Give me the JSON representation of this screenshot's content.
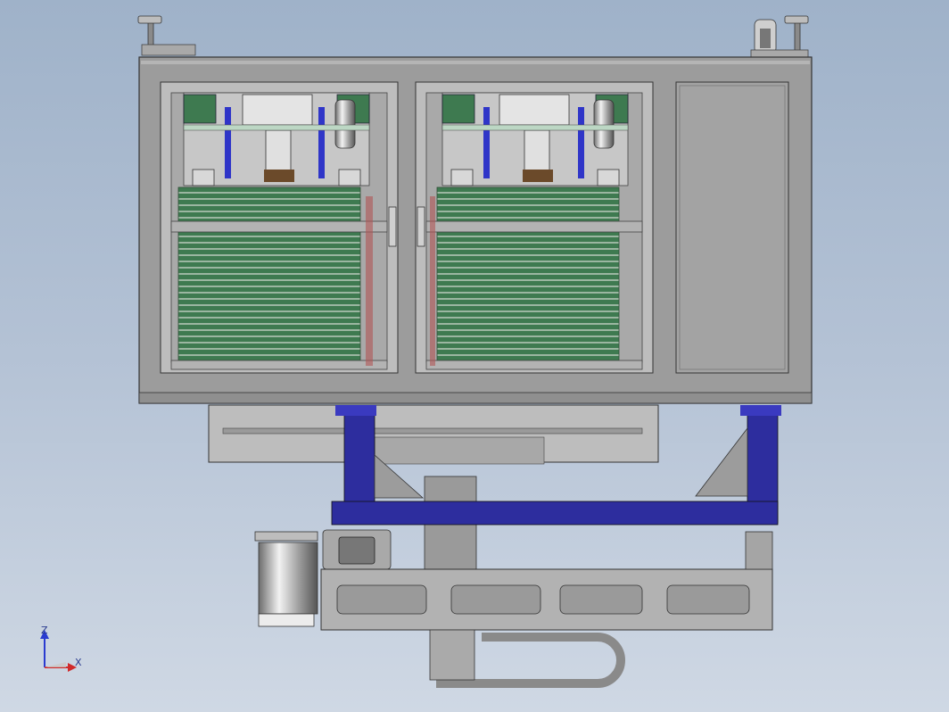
{
  "scene": {
    "background_top": "#9fb2c9",
    "background_bottom": "#cfd8e4",
    "frame_color": "#9c9c9c",
    "tray_color": "#3e7a50",
    "bracket_color": "#2d2d9e"
  },
  "triad": {
    "z_label": "Z",
    "x_label": "X",
    "z_color": "#2a3bd0",
    "x_color": "#d02a2a"
  }
}
